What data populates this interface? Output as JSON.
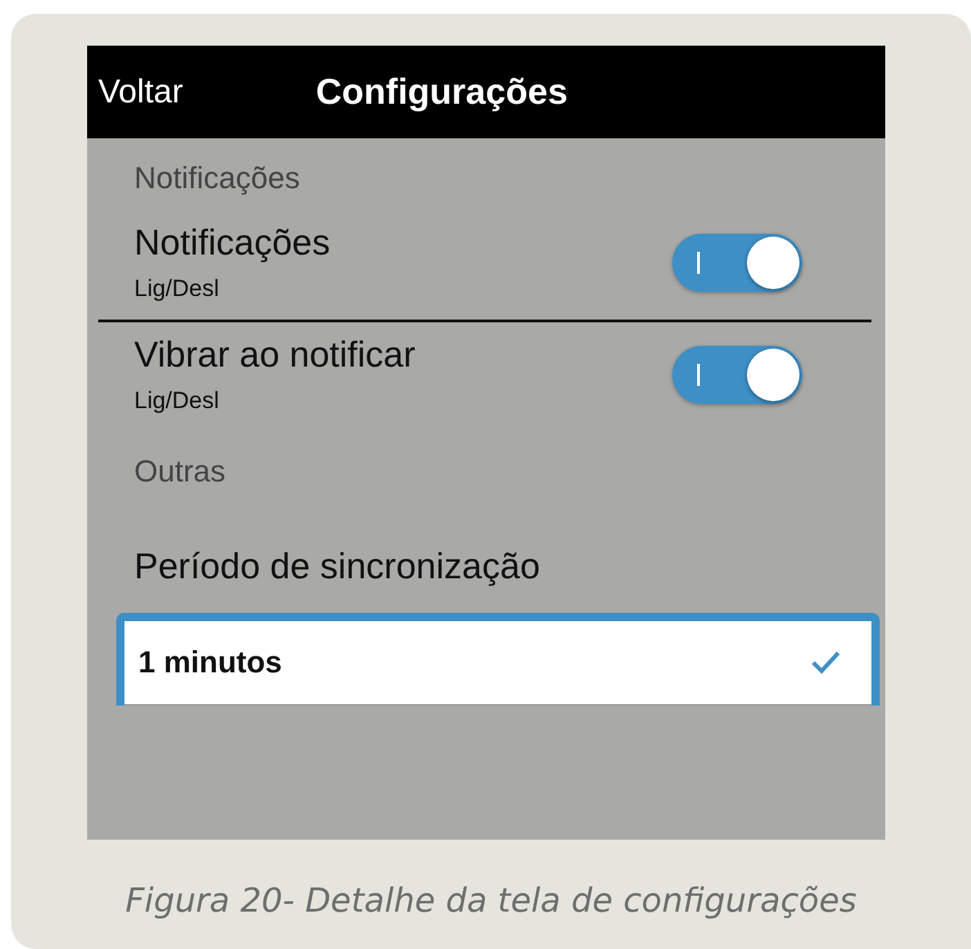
{
  "header": {
    "back": "Voltar",
    "title": "Configurações"
  },
  "sections": [
    {
      "title": "Notificações",
      "items": [
        {
          "kind": "toggle",
          "label": "Notificações",
          "sublabel": "Lig/Desl",
          "on": true
        },
        {
          "kind": "toggle",
          "label": "Vibrar ao notificar",
          "sublabel": "Lig/Desl",
          "on": true
        }
      ]
    },
    {
      "title": "Outras",
      "items": [
        {
          "kind": "choice",
          "label": "Período de sincronização",
          "options": [
            {
              "label": "1 minutos",
              "selected": true
            }
          ]
        }
      ]
    }
  ],
  "caption": "Figura 20- Detalhe da tela de configurações"
}
